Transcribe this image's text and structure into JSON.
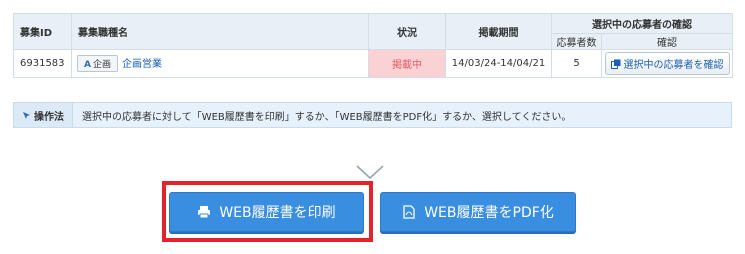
{
  "table": {
    "headers": {
      "id": "募集ID",
      "job_title": "募集職種名",
      "status": "状況",
      "period": "掲載期間",
      "confirm_group": "選択中の応募者の確認",
      "applicant_count": "応募者数",
      "confirm": "確認"
    },
    "row": {
      "id": "6931583",
      "tag_letter": "A",
      "tag_label": "企画",
      "job_title": "企画営業",
      "status": "掲載中",
      "period": "14/03/24-14/04/21",
      "applicant_count": "5",
      "confirm_button": "選択中の応募者を確認"
    }
  },
  "instruction": {
    "label": "操作法",
    "text": "選択中の応募者に対して「WEB履歴書を印刷」するか、「WEB履歴書をPDF化」するか、選択してください。"
  },
  "actions": {
    "print_label": "WEB履歴書を印刷",
    "pdf_label": "WEB履歴書をPDF化"
  },
  "colors": {
    "accent": "#3a8ee0",
    "highlight": "#e4222b",
    "status_bg": "#fbd2d3",
    "status_text": "#e35a67"
  },
  "icons": [
    "copy-icon",
    "pointer-icon",
    "chevron-down-icon",
    "printer-icon",
    "pdf-icon"
  ]
}
